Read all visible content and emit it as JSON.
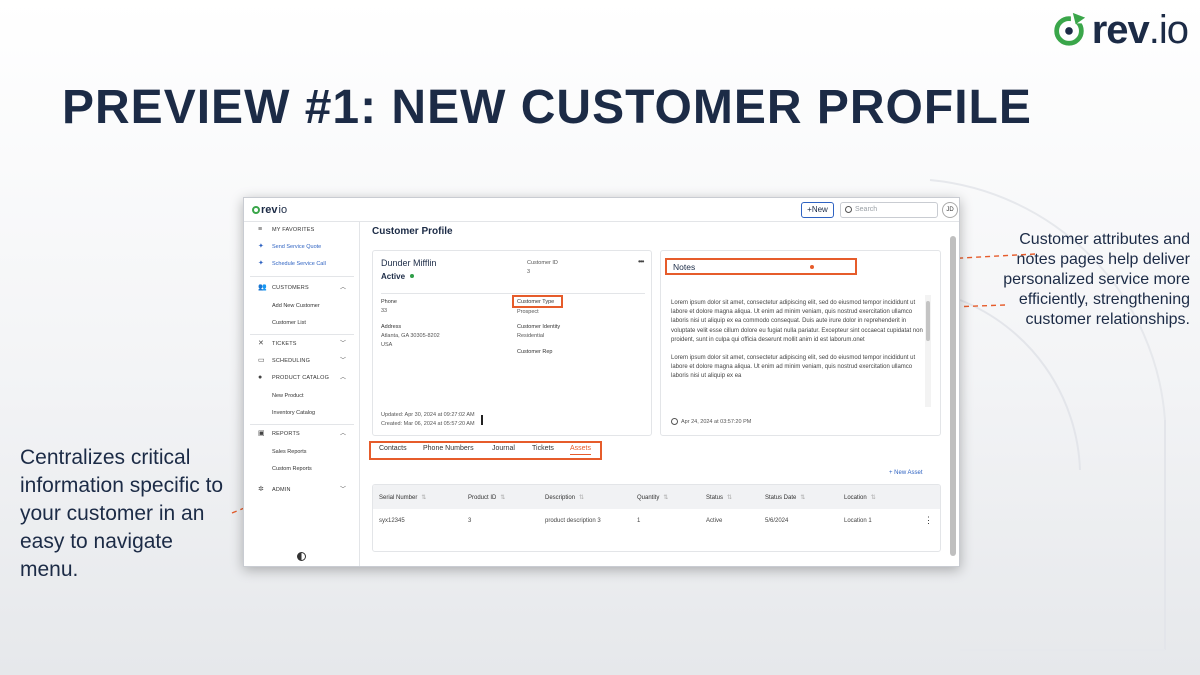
{
  "brand": {
    "word": "rev",
    "suffix": ".io",
    "color": "#3aa64a"
  },
  "slide_title": "PREVIEW #1: NEW CUSTOMER PROFILE",
  "callouts": {
    "right": "Customer attributes and notes pages help deliver personalized service more efficiently, strengthening customer relationships.",
    "left": "Centralizes critical information specific to your customer in an easy to navigate menu."
  },
  "colors": {
    "navy": "#1c2b46",
    "accent": "#e65c2b",
    "link": "#2f63c2",
    "active": "#2e9e47"
  },
  "app": {
    "logo_word": "rev",
    "logo_suffix": "io",
    "new_button": "+New",
    "search_placeholder": "Search",
    "avatar": "JD"
  },
  "sidebar": {
    "favorites": {
      "icon": "menu-icon",
      "label": "MY FAVORITES"
    },
    "fav_items": [
      {
        "icon": "pin-icon",
        "label": "Send Service Quote"
      },
      {
        "icon": "pin-icon",
        "label": "Schedule Service Call"
      }
    ],
    "customers": {
      "icon": "people-icon",
      "label": "CUSTOMERS",
      "items": [
        "Add New Customer",
        "Customer List"
      ]
    },
    "tickets": {
      "icon": "tools-icon",
      "label": "TICKETS"
    },
    "scheduling": {
      "icon": "calendar-icon",
      "label": "SCHEDULING"
    },
    "product_catalog": {
      "icon": "catalog-icon",
      "label": "PRODUCT CATALOG",
      "items": [
        "New Product",
        "Inventory Catalog"
      ]
    },
    "reports": {
      "icon": "chart-icon",
      "label": "REPORTS",
      "items": [
        "Sales Reports",
        "Custom Reports"
      ]
    },
    "admin": {
      "icon": "gear-icon",
      "label": "ADMIN"
    }
  },
  "page_title": "Customer Profile",
  "profile": {
    "name": "Dunder Mifflin",
    "status": "Active",
    "customer_id_label": "Customer ID",
    "customer_id": "3",
    "phone_label": "Phone",
    "phone": "33",
    "address_label": "Address",
    "address_line1": "Atlanta, GA 30305-8202",
    "address_line2": "USA",
    "customer_type_label": "Customer Type",
    "customer_type": "Prospect",
    "customer_identity_label": "Customer Identity",
    "customer_identity": "Residential",
    "customer_rep_label": "Customer Rep",
    "updated": "Updated:  Apr 30, 2024 at 09:27:02 AM",
    "created": "Created:  Mar 06, 2024 at 05:57:20 AM"
  },
  "notes": {
    "title": "Notes",
    "paragraph1": "Lorem ipsum dolor sit amet, consectetur adipiscing elit, sed do eiusmod tempor incididunt ut labore et dolore magna aliqua. Ut enim ad minim veniam, quis nostrud exercitation ullamco laboris nisi ut aliquip ex ea commodo consequat. Duis aute irure dolor in reprehenderit in voluptate velit esse cillum dolore eu fugiat nulla pariatur. Excepteur sint occaecat cupidatat non proident, sunt in culpa qui officia deserunt mollit anim id est laborum.onet",
    "paragraph2": "Lorem ipsum dolor sit amet, consectetur adipiscing elit, sed do eiusmod tempor incididunt ut labore et dolore magna aliqua. Ut enim ad minim veniam, quis nostrud exercitation ullamco laboris nisi ut aliquip ex ea",
    "date": "Apr 24, 2024 at 03:57:20 PM"
  },
  "tabs": [
    "Contacts",
    "Phone Numbers",
    "Journal",
    "Tickets",
    "Assets"
  ],
  "active_tab": "Assets",
  "new_asset": "+ New Asset",
  "table": {
    "columns": [
      "Serial Number",
      "Product ID",
      "Description",
      "Quantity",
      "Status",
      "Status Date",
      "Location"
    ],
    "rows": [
      [
        "syx12345",
        "3",
        "product description 3",
        "1",
        "Active",
        "5/6/2024",
        "Location 1"
      ]
    ]
  }
}
